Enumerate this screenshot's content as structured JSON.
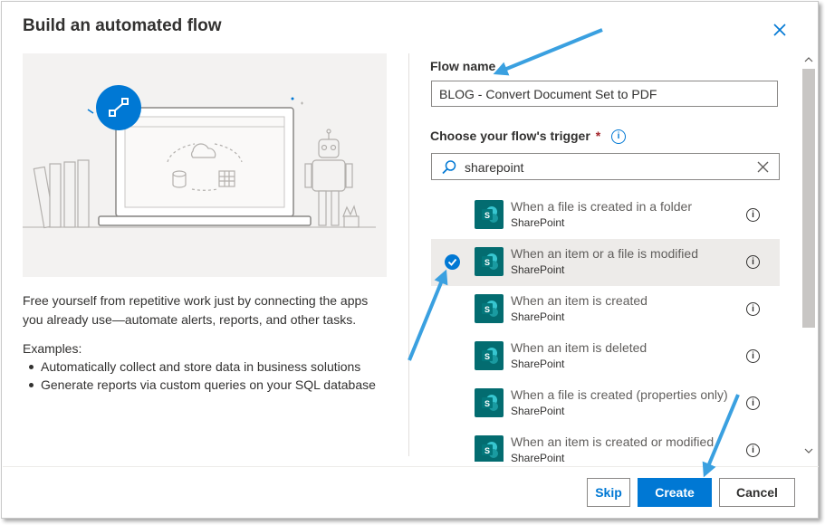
{
  "dialog": {
    "title": "Build an automated flow",
    "description": "Free yourself from repetitive work just by connecting the apps you already use—automate alerts, reports, and other tasks.",
    "examples_title": "Examples:",
    "examples": [
      "Automatically collect and store data in business solutions",
      "Generate reports via custom queries on your SQL database"
    ],
    "flow_name_label": "Flow name",
    "flow_name_value": "BLOG - Convert Document Set to PDF",
    "trigger_label": "Choose your flow's trigger",
    "required_marker": "*",
    "search_value": "sharepoint",
    "triggers": [
      {
        "title": "When a file is created in a folder",
        "app": "SharePoint",
        "selected": false
      },
      {
        "title": "When an item or a file is modified",
        "app": "SharePoint",
        "selected": true
      },
      {
        "title": "When an item is created",
        "app": "SharePoint",
        "selected": false
      },
      {
        "title": "When an item is deleted",
        "app": "SharePoint",
        "selected": false
      },
      {
        "title": "When a file is created (properties only)",
        "app": "SharePoint",
        "selected": false
      },
      {
        "title": "When an item is created or modified",
        "app": "SharePoint",
        "selected": false
      }
    ],
    "buttons": {
      "skip": "Skip",
      "create": "Create",
      "cancel": "Cancel"
    }
  },
  "icons": {
    "close": "close-icon",
    "info": "info-icon",
    "search": "search-icon",
    "clear": "clear-icon",
    "check": "checkmark-icon",
    "app": "sharepoint-icon"
  },
  "colors": {
    "accent": "#0078d4",
    "sharepoint": "#036c70",
    "selected_row": "#edebe9",
    "annotation_arrow": "#3aa0e0"
  }
}
